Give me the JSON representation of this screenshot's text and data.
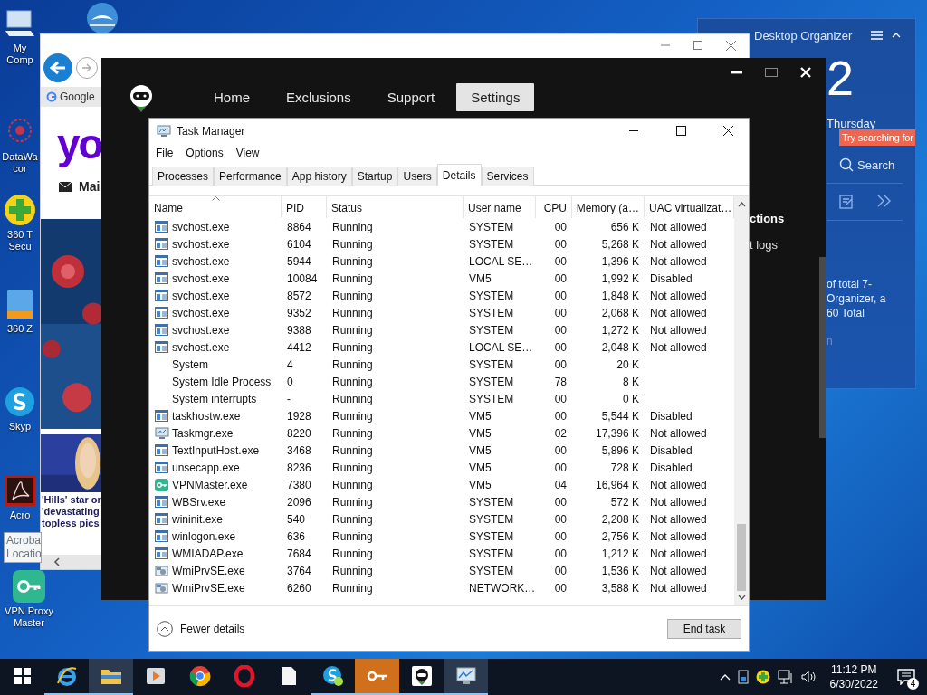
{
  "desktop": {
    "icons": [
      {
        "kind": "computer",
        "label": [
          "My",
          "Comp"
        ]
      },
      {
        "kind": "bird"
      },
      {
        "kind": "network",
        "label": [
          "DataWa",
          "cor"
        ]
      },
      {
        "kind": "plus",
        "label": [
          "360 T",
          "Secu"
        ]
      },
      {
        "kind": "zip",
        "label": [
          "360 Z"
        ]
      },
      {
        "kind": "skype",
        "label": [
          "Skyp"
        ]
      },
      {
        "kind": "pdf",
        "label": [
          "Acro"
        ]
      },
      {
        "kind": "key",
        "label": [
          "VPN Proxy",
          "Master"
        ]
      }
    ],
    "tooltip": [
      "Acroba",
      "Locatio"
    ]
  },
  "organizer": {
    "title": "Desktop Organizer",
    "clock": "2",
    "day": "Thursday",
    "tip": "Try searching for",
    "search": "Search",
    "text": [
      "of total 7-",
      "Organizer, a",
      "60 Total"
    ],
    "trailing": "n"
  },
  "browser": {
    "tab": "Google",
    "logo": "yo",
    "mail": "Mai",
    "headline": "'Hills' star or 'devastating topless pics"
  },
  "vpn": {
    "nav": [
      {
        "label": "Home",
        "selected": false
      },
      {
        "label": "Exclusions",
        "selected": false
      },
      {
        "label": "Support",
        "selected": false
      },
      {
        "label": "Settings",
        "selected": true
      }
    ],
    "section": "ctions",
    "link": "t logs"
  },
  "taskManager": {
    "title": "Task Manager",
    "menu": [
      "File",
      "Options",
      "View"
    ],
    "tabs": [
      {
        "label": "Processes",
        "selected": false
      },
      {
        "label": "Performance",
        "selected": false
      },
      {
        "label": "App history",
        "selected": false
      },
      {
        "label": "Startup",
        "selected": false
      },
      {
        "label": "Users",
        "selected": false
      },
      {
        "label": "Details",
        "selected": true
      },
      {
        "label": "Services",
        "selected": false
      }
    ],
    "columns": [
      "Name",
      "PID",
      "Status",
      "User name",
      "CPU",
      "Memory (a…",
      "UAC virtualizat…"
    ],
    "rows": [
      {
        "kind": "app",
        "name": "svchost.exe",
        "pid": "8864",
        "status": "Running",
        "user": "SYSTEM",
        "cpu": "00",
        "memory": "656 K",
        "uac": "Not allowed"
      },
      {
        "kind": "app",
        "name": "svchost.exe",
        "pid": "6104",
        "status": "Running",
        "user": "SYSTEM",
        "cpu": "00",
        "memory": "5,268 K",
        "uac": "Not allowed"
      },
      {
        "kind": "app",
        "name": "svchost.exe",
        "pid": "5944",
        "status": "Running",
        "user": "LOCAL SE…",
        "cpu": "00",
        "memory": "1,396 K",
        "uac": "Not allowed"
      },
      {
        "kind": "app",
        "name": "svchost.exe",
        "pid": "10084",
        "status": "Running",
        "user": "VM5",
        "cpu": "00",
        "memory": "1,992 K",
        "uac": "Disabled"
      },
      {
        "kind": "app",
        "name": "svchost.exe",
        "pid": "8572",
        "status": "Running",
        "user": "SYSTEM",
        "cpu": "00",
        "memory": "1,848 K",
        "uac": "Not allowed"
      },
      {
        "kind": "app",
        "name": "svchost.exe",
        "pid": "9352",
        "status": "Running",
        "user": "SYSTEM",
        "cpu": "00",
        "memory": "2,068 K",
        "uac": "Not allowed"
      },
      {
        "kind": "app",
        "name": "svchost.exe",
        "pid": "9388",
        "status": "Running",
        "user": "SYSTEM",
        "cpu": "00",
        "memory": "1,272 K",
        "uac": "Not allowed"
      },
      {
        "kind": "app",
        "name": "svchost.exe",
        "pid": "4412",
        "status": "Running",
        "user": "LOCAL SE…",
        "cpu": "00",
        "memory": "2,048 K",
        "uac": "Not allowed"
      },
      {
        "kind": "plain",
        "name": "System",
        "pid": "4",
        "status": "Running",
        "user": "SYSTEM",
        "cpu": "00",
        "memory": "20 K"
      },
      {
        "kind": "plain",
        "name": "System Idle Process",
        "pid": "0",
        "status": "Running",
        "user": "SYSTEM",
        "cpu": "78",
        "memory": "8 K"
      },
      {
        "kind": "plain",
        "name": "System interrupts",
        "pid": "-",
        "status": "Running",
        "user": "SYSTEM",
        "cpu": "00",
        "memory": "0 K"
      },
      {
        "kind": "app",
        "name": "taskhostw.exe",
        "pid": "1928",
        "status": "Running",
        "user": "VM5",
        "cpu": "00",
        "memory": "5,544 K",
        "uac": "Disabled"
      },
      {
        "kind": "monitor",
        "name": "Taskmgr.exe",
        "pid": "8220",
        "status": "Running",
        "user": "VM5",
        "cpu": "02",
        "memory": "17,396 K",
        "uac": "Not allowed"
      },
      {
        "kind": "app",
        "name": "TextInputHost.exe",
        "pid": "3468",
        "status": "Running",
        "user": "VM5",
        "cpu": "00",
        "memory": "5,896 K",
        "uac": "Disabled"
      },
      {
        "kind": "app",
        "name": "unsecapp.exe",
        "pid": "8236",
        "status": "Running",
        "user": "VM5",
        "cpu": "00",
        "memory": "728 K",
        "uac": "Disabled"
      },
      {
        "kind": "key",
        "name": "VPNMaster.exe",
        "pid": "7380",
        "status": "Running",
        "user": "VM5",
        "cpu": "04",
        "memory": "16,964 K",
        "uac": "Not allowed"
      },
      {
        "kind": "app",
        "name": "WBSrv.exe",
        "pid": "2096",
        "status": "Running",
        "user": "SYSTEM",
        "cpu": "00",
        "memory": "572 K",
        "uac": "Not allowed"
      },
      {
        "kind": "app",
        "name": "wininit.exe",
        "pid": "540",
        "status": "Running",
        "user": "SYSTEM",
        "cpu": "00",
        "memory": "2,208 K",
        "uac": "Not allowed"
      },
      {
        "kind": "app",
        "name": "winlogon.exe",
        "pid": "636",
        "status": "Running",
        "user": "SYSTEM",
        "cpu": "00",
        "memory": "2,756 K",
        "uac": "Not allowed"
      },
      {
        "kind": "app",
        "name": "WMIADAP.exe",
        "pid": "7684",
        "status": "Running",
        "user": "SYSTEM",
        "cpu": "00",
        "memory": "1,212 K",
        "uac": "Not allowed"
      },
      {
        "kind": "service",
        "name": "WmiPrvSE.exe",
        "pid": "3764",
        "status": "Running",
        "user": "SYSTEM",
        "cpu": "00",
        "memory": "1,536 K",
        "uac": "Not allowed"
      },
      {
        "kind": "service",
        "name": "WmiPrvSE.exe",
        "pid": "6260",
        "status": "Running",
        "user": "NETWORK…",
        "cpu": "00",
        "memory": "3,588 K",
        "uac": "Not allowed"
      }
    ],
    "toggle": "Fewer details",
    "endTask": "End task"
  },
  "taskbar": {
    "items": [
      {
        "kind": "start",
        "selected": false,
        "running": false,
        "flashing": false
      },
      {
        "kind": "ie",
        "selected": false,
        "running": true,
        "flashing": false
      },
      {
        "kind": "folder",
        "selected": true,
        "running": true,
        "flashing": false
      },
      {
        "kind": "media",
        "selected": false,
        "running": false,
        "flashing": false
      },
      {
        "kind": "chrome",
        "selected": false,
        "running": false,
        "flashing": false
      },
      {
        "kind": "opera",
        "selected": false,
        "running": false,
        "flashing": false
      },
      {
        "kind": "file",
        "selected": false,
        "running": false,
        "flashing": false
      },
      {
        "kind": "skype",
        "selected": false,
        "running": true,
        "flashing": false
      },
      {
        "kind": "key",
        "selected": false,
        "running": true,
        "flashing": true
      },
      {
        "kind": "robot",
        "selected": false,
        "running": true,
        "flashing": false
      },
      {
        "kind": "monitor",
        "selected": true,
        "running": true,
        "flashing": false
      }
    ],
    "time": "11:12 PM",
    "date": "6/30/2022",
    "notifications": "4"
  }
}
